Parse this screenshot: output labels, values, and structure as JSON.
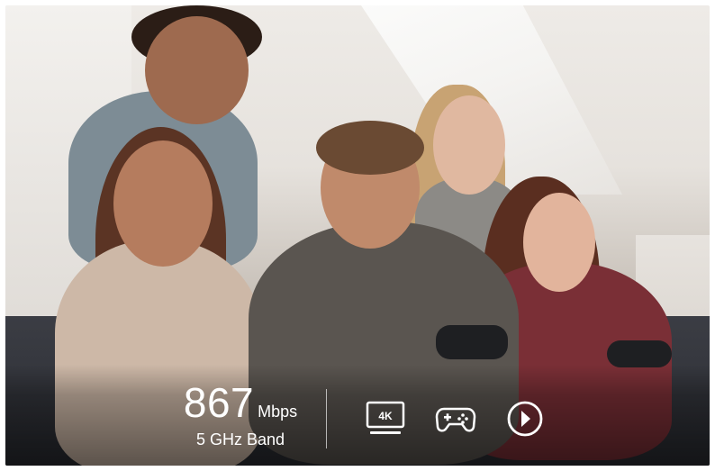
{
  "hero": {
    "speed_value": "867",
    "speed_unit": "Mbps",
    "band_label": "5 GHz Band",
    "icons": [
      "4k-display-icon",
      "gamepad-icon",
      "play-circle-icon"
    ],
    "icon_text_4k": "4K"
  },
  "colors": {
    "overlay_text": "#ffffff"
  }
}
